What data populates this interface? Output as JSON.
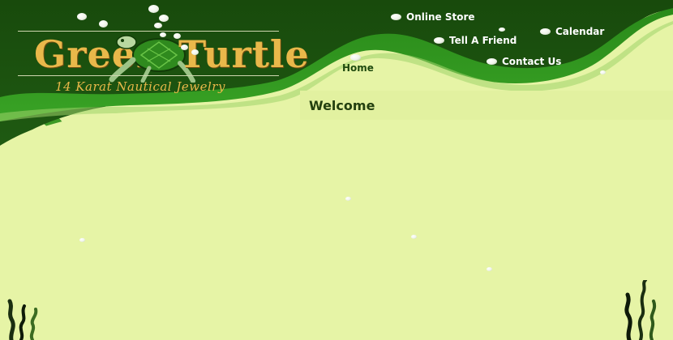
{
  "brand": {
    "word_left": "Green",
    "word_right": "Turtle",
    "tagline": "14 Karat Nautical Jewelry"
  },
  "nav": {
    "home": "Home",
    "online_store": "Online Store",
    "tell_a_friend": "Tell A Friend",
    "calendar": "Calendar",
    "contact_us": "Contact Us"
  },
  "main": {
    "heading": "Welcome"
  },
  "colors": {
    "background": "#e6f4a6",
    "wave_dark": "#1f5a12",
    "wave_mid": "#2f8a1e",
    "logo_gold": "#e9b84a",
    "nav_text": "#ffffff",
    "heading_text": "#23400f"
  },
  "icons": {
    "nav_bullet": "pearl-icon",
    "logo_mascot": "turtle-icon",
    "decor_left": "seaweed-icon",
    "decor_right": "seaweed-icon"
  }
}
